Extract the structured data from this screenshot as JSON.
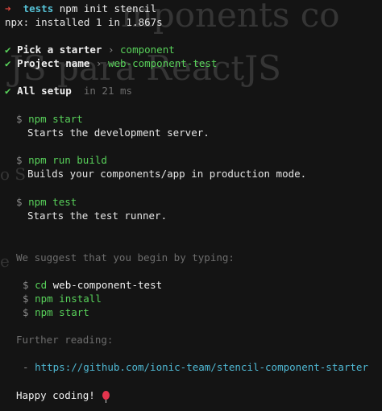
{
  "ghost": {
    "line1": "mponents co",
    "line2": "JS para ReactJS",
    "line3": "o S",
    "line4": "e"
  },
  "prompt": {
    "arrow": "➜",
    "dir": "tests",
    "command": "npm init stencil"
  },
  "npx_line": "npx: installed 1 in 1.867s",
  "steps": [
    {
      "check": "✔",
      "label": "Pick a starter",
      "sep": "›",
      "value": "component"
    },
    {
      "check": "✔",
      "label": "Project name",
      "sep": "›",
      "value": "web-component-test"
    }
  ],
  "setup": {
    "check": "✔",
    "label": "All setup",
    "time": "in 21 ms"
  },
  "commands": [
    {
      "dollar": "$",
      "cmd": "npm start",
      "desc": "Starts the development server."
    },
    {
      "dollar": "$",
      "cmd": "npm run build",
      "desc": "Builds your components/app in production mode."
    },
    {
      "dollar": "$",
      "cmd": "npm test",
      "desc": "Starts the test runner."
    }
  ],
  "suggest": "We suggest that you begin by typing:",
  "suggest_cmds": [
    {
      "dollar": "$",
      "cmd": "cd",
      "arg": "web-component-test"
    },
    {
      "dollar": "$",
      "cmd": "npm install",
      "arg": ""
    },
    {
      "dollar": "$",
      "cmd": "npm start",
      "arg": ""
    }
  ],
  "further": "Further reading:",
  "link": {
    "dash": "-",
    "url": "https://github.com/ionic-team/stencil-component-starter"
  },
  "happy": "Happy coding!",
  "colors": {
    "background": "#141414",
    "green": "#58d15a",
    "cyan": "#56c2d6",
    "red": "#e0493f"
  }
}
